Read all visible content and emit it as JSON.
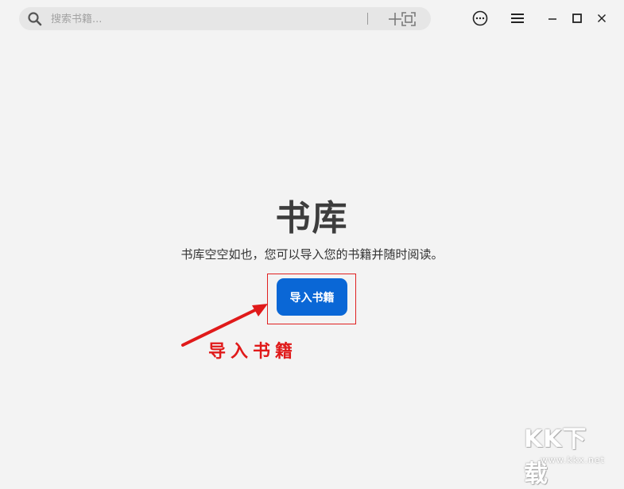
{
  "search": {
    "placeholder": "搜索书籍...",
    "value": ""
  },
  "toolbar": {
    "add_icon": "plus-icon",
    "scan_icon": "scan-frame-icon",
    "more_icon": "more-circle-icon",
    "menu_icon": "hamburger-menu-icon"
  },
  "window_controls": {
    "minimize_icon": "minimize-icon",
    "maximize_icon": "maximize-icon",
    "close_icon": "close-icon"
  },
  "library": {
    "title": "书库",
    "subtitle": "书库空空如也，您可以导入您的书籍并随时阅读。",
    "import_label": "导入书籍"
  },
  "annotation": {
    "label": "导入书籍",
    "color": "#e01a1a"
  },
  "watermark": {
    "logo": "KK下载",
    "url": "www.kkx.net"
  },
  "colors": {
    "accent": "#0a67d6",
    "background": "#f3f3f3"
  }
}
